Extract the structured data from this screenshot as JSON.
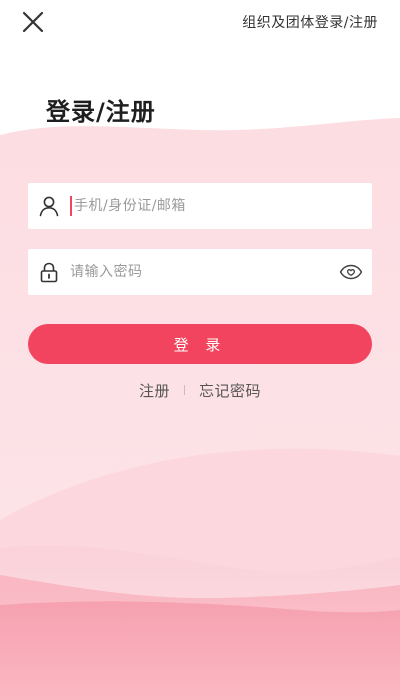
{
  "header": {
    "close_icon": "close-icon",
    "org_link_label": "组织及团体登录/注册"
  },
  "page_title": "登录/注册",
  "account_field": {
    "icon": "user-icon",
    "placeholder": "手机/身份证/邮箱",
    "value": ""
  },
  "password_field": {
    "icon": "lock-icon",
    "placeholder": "请输入密码",
    "value": "",
    "toggle_icon": "eye-icon"
  },
  "login_button": {
    "label": "登 录"
  },
  "links": {
    "register_label": "注册",
    "forgot_label": "忘记密码"
  },
  "colors": {
    "accent": "#f2445e",
    "caret": "#f0475f",
    "background_pink": "#fde2e6",
    "text_dark": "#1f1f1f"
  }
}
